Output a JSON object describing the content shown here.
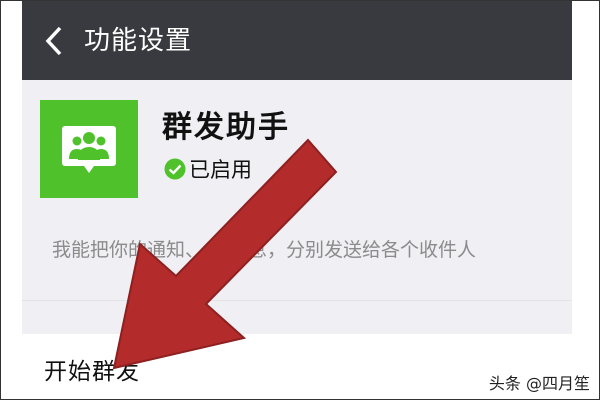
{
  "header": {
    "title": "功能设置"
  },
  "app": {
    "name": "群发助手",
    "status": "已启用",
    "description": "我能把你的通知、 等消息，分别发送给各个收件人"
  },
  "action": {
    "label": "开始群发"
  },
  "watermark": "头条 @四月笙",
  "colors": {
    "titlebar": "#393a3f",
    "accent": "#4fc22b",
    "arrow": "#b32b2b"
  }
}
